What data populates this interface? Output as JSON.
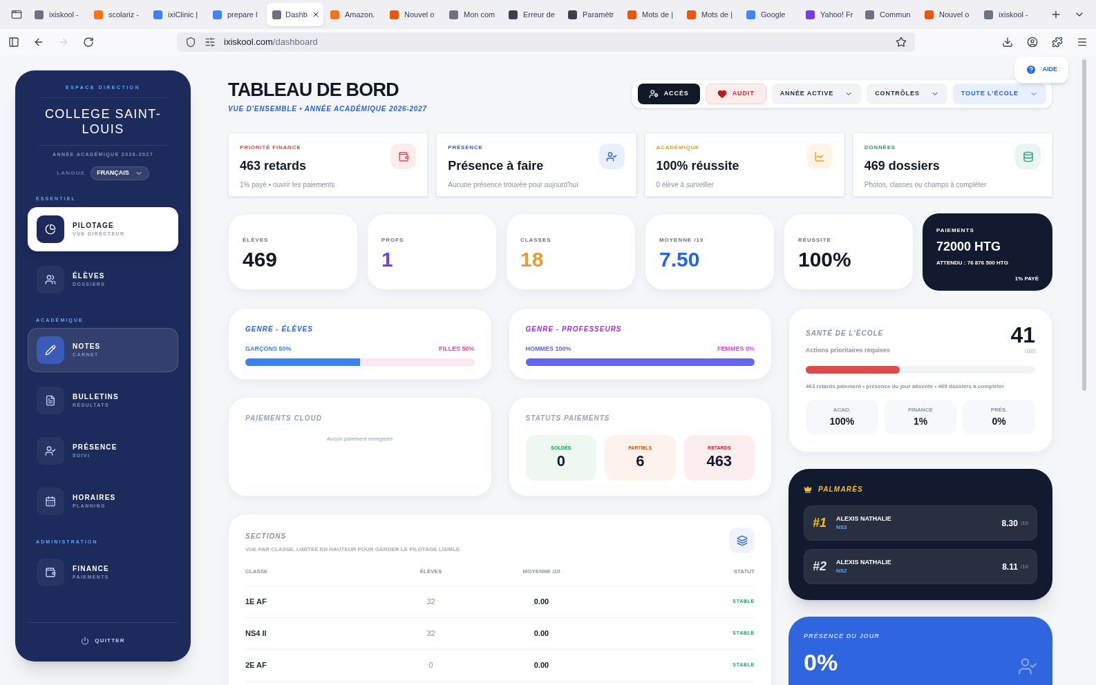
{
  "browser": {
    "tabs": [
      {
        "title": "ixiskool -",
        "color": "#6b7280",
        "selected": false
      },
      {
        "title": "scolariz -",
        "color": "#f97316",
        "selected": false
      },
      {
        "title": "ixiClinic |",
        "color": "#3b82f6",
        "selected": false
      },
      {
        "title": "prepare l",
        "color": "#4285f4",
        "selected": false
      },
      {
        "title": "Dashb",
        "color": "#6b7280",
        "selected": true
      },
      {
        "title": "Amazon.",
        "color": "#f97316",
        "selected": false
      },
      {
        "title": "Nouvel o",
        "color": "#e8590c",
        "selected": false
      },
      {
        "title": "Mon com",
        "color": "#6b7280",
        "selected": false
      },
      {
        "title": "Erreur de",
        "color": "#374151",
        "selected": false
      },
      {
        "title": "Paramètr",
        "color": "#374151",
        "selected": false
      },
      {
        "title": "Mots de |",
        "color": "#e8590c",
        "selected": false
      },
      {
        "title": "Mots de |",
        "color": "#e8590c",
        "selected": false
      },
      {
        "title": "Google",
        "color": "#4285f4",
        "selected": false
      },
      {
        "title": "Yahoo! Fr",
        "color": "#7c3aed",
        "selected": false
      },
      {
        "title": "Commun",
        "color": "#6b7280",
        "selected": false
      },
      {
        "title": "Nouvel o",
        "color": "#e8590c",
        "selected": false
      },
      {
        "title": "ixiskool -",
        "color": "#6b7280",
        "selected": false
      }
    ],
    "address": {
      "host": "ixiskool.com",
      "path": "/dashboard"
    }
  },
  "sidebar": {
    "eyebrow": "ESPACE DIRECTION",
    "school": "COLLEGE SAINT-LOUIS",
    "year": "ANNÉE ACADÉMIQUE 2026-2027",
    "language_label": "LANGUE",
    "language": "FRANÇAIS",
    "sections": [
      {
        "title": "ESSENTIEL",
        "items": [
          {
            "label": "PILOTAGE",
            "sub": "VUE DIRECTEUR",
            "selected": true,
            "hovered": false
          },
          {
            "label": "ÉLÈVES",
            "sub": "DOSSIERS",
            "selected": false,
            "hovered": false
          }
        ]
      },
      {
        "title": "ACADÉMIQUE",
        "items": [
          {
            "label": "NOTES",
            "sub": "CARNET",
            "selected": false,
            "hovered": true
          },
          {
            "label": "BULLETINS",
            "sub": "RÉSULTATS",
            "selected": false,
            "hovered": false
          },
          {
            "label": "PRÉSENCE",
            "sub": "SUIVI",
            "selected": false,
            "hovered": false
          },
          {
            "label": "HORAIRES",
            "sub": "PLANNING",
            "selected": false,
            "hovered": false
          }
        ]
      },
      {
        "title": "ADMINISTRATION",
        "items": [
          {
            "label": "FINANCE",
            "sub": "PAIEMENTS",
            "selected": false,
            "hovered": false
          }
        ]
      }
    ],
    "logout": "QUITTER"
  },
  "help": "AIDE",
  "header": {
    "title": "TABLEAU DE BORD",
    "subtitle": "VUE D'ENSEMBLE • ANNÉE ACADÉMIQUE 2026-2027",
    "actions": [
      {
        "label": "ACCÈS",
        "kind": "dark"
      },
      {
        "label": "AUDIT",
        "kind": "danger"
      },
      {
        "label": "ANNÉE ACTIVE",
        "kind": "select"
      },
      {
        "label": "CONTRÔLES",
        "kind": "select"
      },
      {
        "label": "TOUTE L'ÉCOLE",
        "kind": "accent"
      }
    ]
  },
  "alerts": [
    {
      "label": "PRIORITÉ FINANCE",
      "title": "463 retards",
      "note": "1% payé • ouvrir les paiements",
      "color": "#ef4444"
    },
    {
      "label": "PRÉSENCE",
      "title": "Présence à faire",
      "note": "Aucune présence trouvée pour aujourd'hui",
      "color": "#2563eb"
    },
    {
      "label": "ACADÉMIQUE",
      "title": "100% réussite",
      "note": "0 élève à surveiller",
      "color": "#f59e0b"
    },
    {
      "label": "DONNÉES",
      "title": "469 dossiers",
      "note": "Photos, classes ou champs à compléter",
      "color": "#22a06b"
    }
  ],
  "stats": [
    {
      "kind": "stat",
      "label": "ÉLÈVES",
      "value": "469",
      "color": "#111827"
    },
    {
      "kind": "stat",
      "label": "PROFS",
      "value": "1",
      "color": "#7c3aed"
    },
    {
      "kind": "stat",
      "label": "CLASSES",
      "value": "18",
      "color": "#ea9a2e"
    },
    {
      "kind": "stat",
      "label": "MOYENNE /10",
      "value": "7.50",
      "color": "#2563eb"
    },
    {
      "kind": "stat",
      "label": "RÉUSSITE",
      "value": "100%",
      "color": "#111827"
    },
    {
      "kind": "payment",
      "label": "PAIEMENTS",
      "value": "72000 HTG",
      "expected": "ATTENDU : 76 876 500 HTG",
      "note": "1% PAYÉ"
    }
  ],
  "gender": [
    {
      "title": "GENRE - ÉLÈVES",
      "color": "#2563eb",
      "left": {
        "text": "GARÇONS 50%",
        "color": "#3b82f6"
      },
      "right": {
        "text": "FILLES 50%",
        "color": "#ec4899"
      },
      "level": 0.5
    },
    {
      "title": "GENRE - PROFESSEURS",
      "color": "#9333ea",
      "left": {
        "text": "HOMMES 100%",
        "color": "#6366f1"
      },
      "right": {
        "text": "FEMMES 0%",
        "color": "#d946ef"
      },
      "level": 1
    }
  ],
  "cloud": {
    "title": "PAIEMENTS CLOUD",
    "empty": "Aucun paiement enregistré"
  },
  "statuses": {
    "title": "STATUTS PAIEMENTS",
    "items": [
      {
        "label": "SOLDÉS",
        "value": "0",
        "color": "#16a34a"
      },
      {
        "label": "PARTIELS",
        "value": "6",
        "color": "#ea580c"
      },
      {
        "label": "RETARDS",
        "value": "463",
        "color": "#dc2626"
      }
    ]
  },
  "health": {
    "title": "SANTÉ DE L'ÉCOLE",
    "subtitle": "Actions prioritaires requises",
    "score": "41",
    "max": "/100",
    "level": 0.41,
    "summary": "463 retards paiement • présence du jour absente • 469 dossiers à compléter",
    "metrics": [
      {
        "label": "ACAD.",
        "value": "100%"
      },
      {
        "label": "FINANCE",
        "value": "1%"
      },
      {
        "label": "PRÉS.",
        "value": "0%"
      }
    ]
  },
  "ranking": {
    "title": "PALMARÈS",
    "rows": [
      {
        "rank": "#1",
        "name": "ALEXIS NATHALIE",
        "class": "NS3",
        "score": "8.30",
        "unit": "/10",
        "color": "#fbbf24"
      },
      {
        "rank": "#2",
        "name": "ALEXIS NATHALIE",
        "class": "NS2",
        "score": "8.11",
        "unit": "/10",
        "color": "#e5e7eb"
      }
    ]
  },
  "presence": {
    "title": "PRÉSENCE DU JOUR",
    "value": "0%"
  },
  "sections": {
    "title": "SECTIONS",
    "subtitle": "VUE PAR CLASSE, LIMITÉE EN HAUTEUR POUR GARDER LE PILOTAGE LISIBLE",
    "columns": [
      "CLASSE",
      "ÉLÈVES",
      "MOYENNE /10",
      "STATUT"
    ],
    "rows": [
      [
        "1E AF",
        "32",
        "0.00",
        "STABLE"
      ],
      [
        "NS4 II",
        "32",
        "0.00",
        "STABLE"
      ],
      [
        "2E AF",
        "0",
        "0.00",
        "STABLE"
      ]
    ]
  }
}
